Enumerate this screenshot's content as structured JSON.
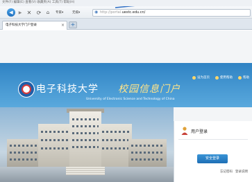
{
  "browser": {
    "menu_strip": "文件(F)  编辑(E)  查看(V)  收藏夹(A)  工具(T)  帮助(H)",
    "toolbar": {
      "back_icon": "back-arrow-icon",
      "forward_icon": "forward-arrow-icon",
      "stop_icon": "close-x-icon",
      "refresh_icon": "refresh-icon",
      "home_icon": "home-icon",
      "security_label": "专家▾",
      "view_label": "无痕▾"
    },
    "address": {
      "prefix": "http://portal.",
      "domain": "uestc.edu.cn/"
    },
    "tab": {
      "label": "电子科技大学门户登录",
      "close": "×"
    },
    "new_tab": "+"
  },
  "page": {
    "top_links": [
      {
        "label": "设为首页",
        "icon": "home-icon"
      },
      {
        "label": "使用帮助",
        "icon": "help-icon"
      },
      {
        "label": "帮助",
        "icon": "info-icon"
      }
    ],
    "school_name": "电子科技大学",
    "portal_name": "校园信息门户",
    "school_en": "University of Electronic Science and Technology of China",
    "login": {
      "title": "用户登录",
      "button": "安全登录",
      "links": [
        "忘记密码",
        "登录说明"
      ]
    }
  },
  "colors": {
    "hero_blue": "#2f83c4",
    "login_button": "#1e6fb5",
    "portal_title": "#ffe48a"
  }
}
